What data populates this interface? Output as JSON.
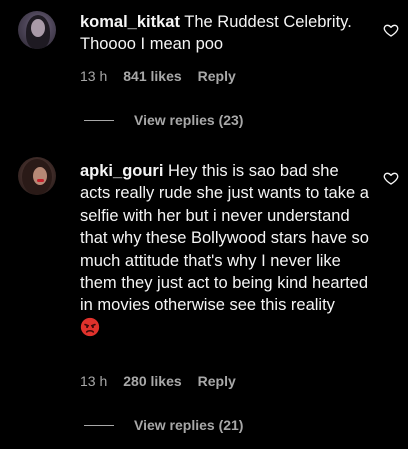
{
  "comments": [
    {
      "username": "komal_kitkat",
      "text": "The Ruddest Celebrity. Thoooo I mean poo",
      "time": "13 h",
      "likes": "841 likes",
      "reply": "Reply",
      "view_replies": "View replies (23)"
    },
    {
      "username": "apki_gouri",
      "text": "Hey this is sao bad she acts really rude she just wants to take a selfie with her but i never understand that why these Bollywood stars have so much attitude that's why I never like them they just act to being kind hearted in movies otherwise see this reality",
      "emoji": "angry-face",
      "time": "13 h",
      "likes": "280 likes",
      "reply": "Reply",
      "view_replies": "View replies (21)"
    }
  ],
  "colors": {
    "background": "#000000",
    "text": "#f5f5f5",
    "secondary": "#a8a8a8",
    "emoji": "#e0322c"
  }
}
